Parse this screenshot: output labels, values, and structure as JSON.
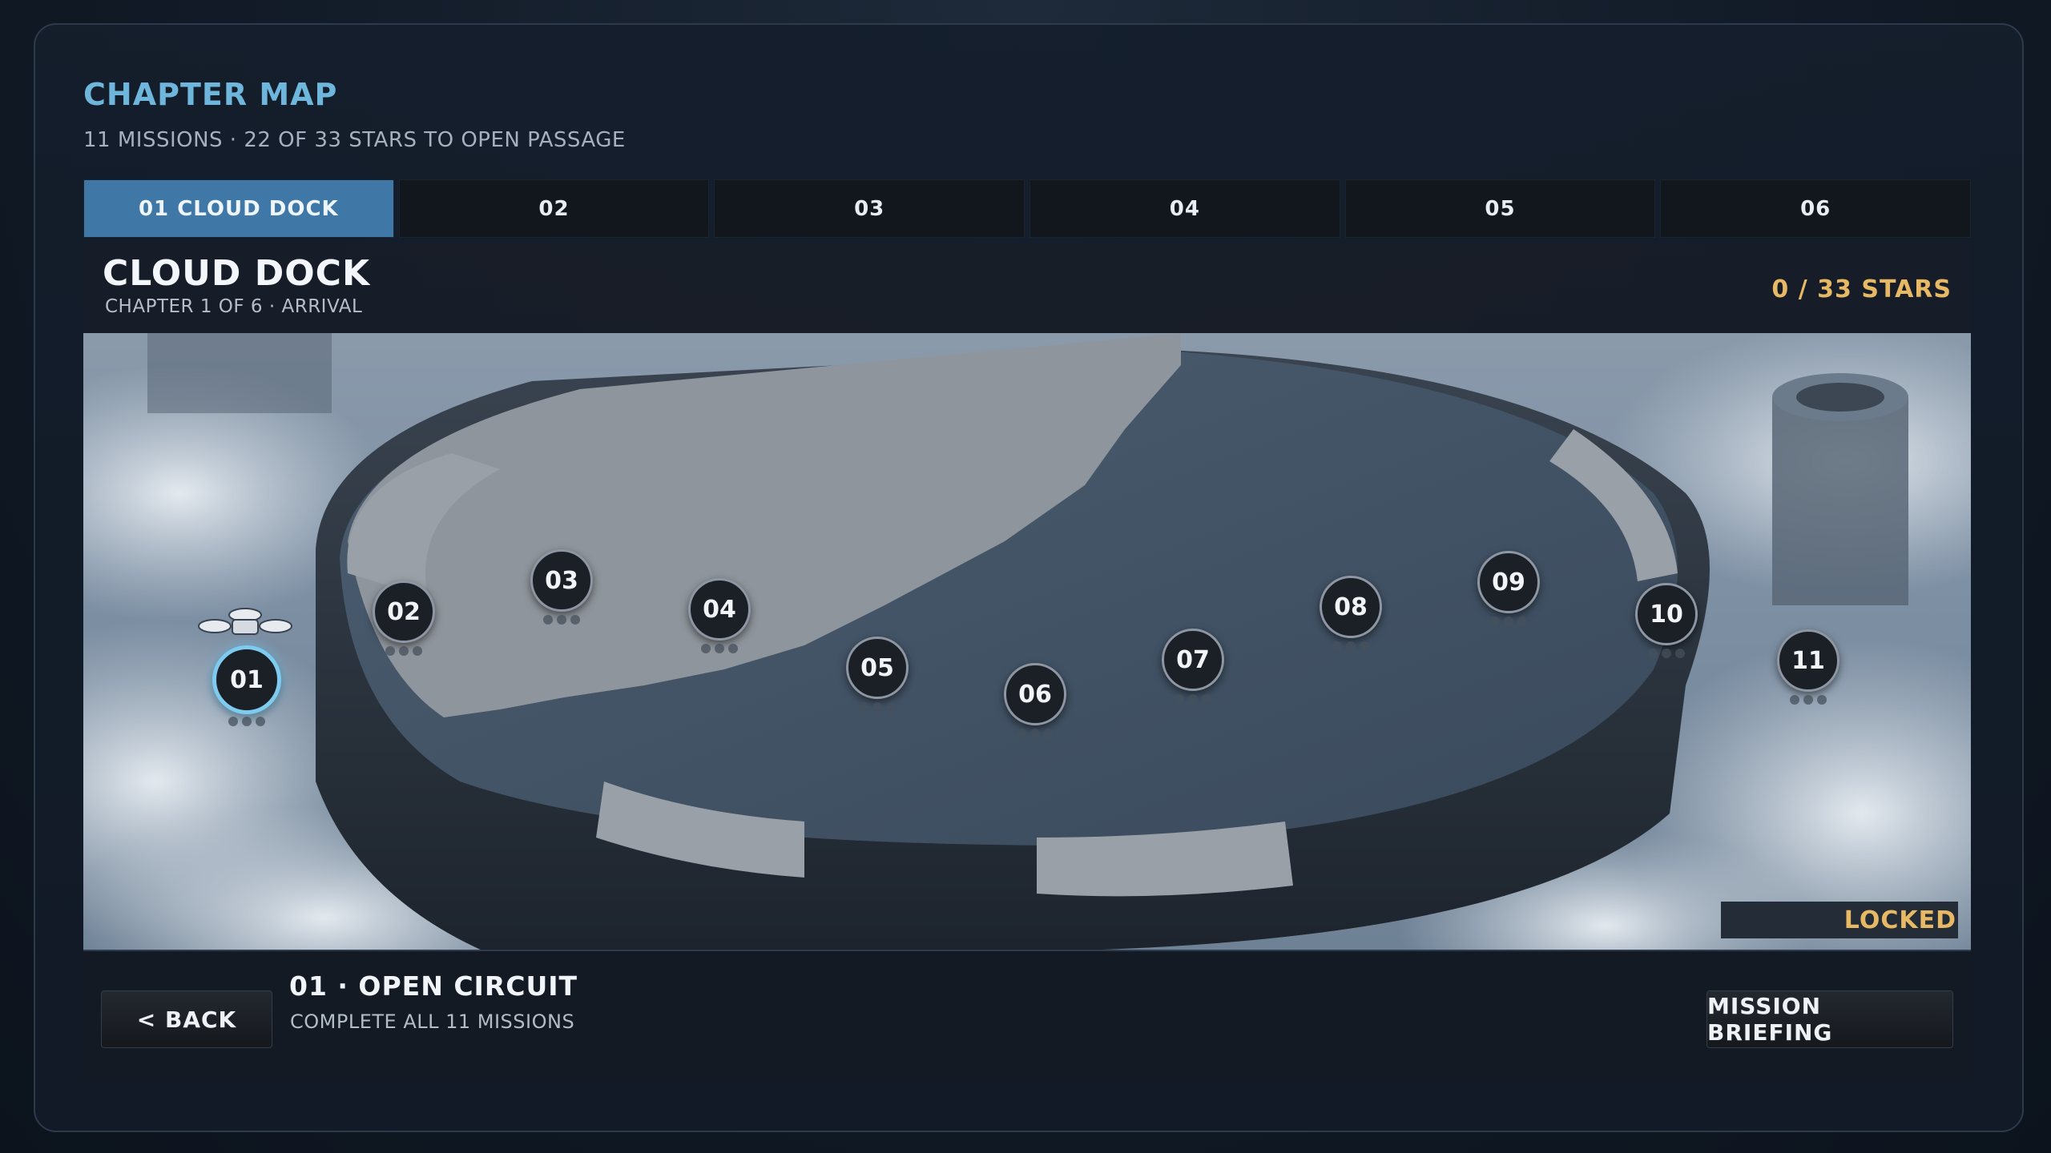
{
  "header": {
    "title": "CHAPTER MAP",
    "subtitle": "11 MISSIONS · 22 OF 33 STARS TO OPEN PASSAGE"
  },
  "tabs": [
    {
      "label": "01  CLOUD DOCK",
      "active": true
    },
    {
      "label": "02",
      "active": false
    },
    {
      "label": "03",
      "active": false
    },
    {
      "label": "04",
      "active": false
    },
    {
      "label": "05",
      "active": false
    },
    {
      "label": "06",
      "active": false
    }
  ],
  "chapter": {
    "name": "CLOUD DOCK",
    "info": "CHAPTER 1 OF 6  ·  ARRIVAL",
    "stars": "0 / 33 STARS"
  },
  "map": {
    "missions": [
      {
        "number": "01",
        "stars_earned": 0,
        "current": true
      },
      {
        "number": "02",
        "stars_earned": 0
      },
      {
        "number": "03",
        "stars_earned": 0
      },
      {
        "number": "04",
        "stars_earned": 0
      },
      {
        "number": "05",
        "stars_earned": 0
      },
      {
        "number": "06",
        "stars_earned": 0
      },
      {
        "number": "07",
        "stars_earned": 0
      },
      {
        "number": "08",
        "stars_earned": 0
      },
      {
        "number": "09",
        "stars_earned": 0
      },
      {
        "number": "10",
        "stars_earned": 0
      },
      {
        "number": "11",
        "stars_earned": 0
      }
    ],
    "locked_label": "LOCKED"
  },
  "footer": {
    "back_label": "<  BACK",
    "mission_title": "01 · OPEN CIRCUIT",
    "mission_sub": "COMPLETE ALL 11 MISSIONS",
    "briefing_label": "MISSION BRIEFING"
  },
  "icons": {
    "player_marker": "drone-icon"
  },
  "colors": {
    "accent": "#6fb6dc",
    "active_tab": "#3f78a6",
    "stars": "#e8b964",
    "current_ring": "#7ecbef"
  }
}
